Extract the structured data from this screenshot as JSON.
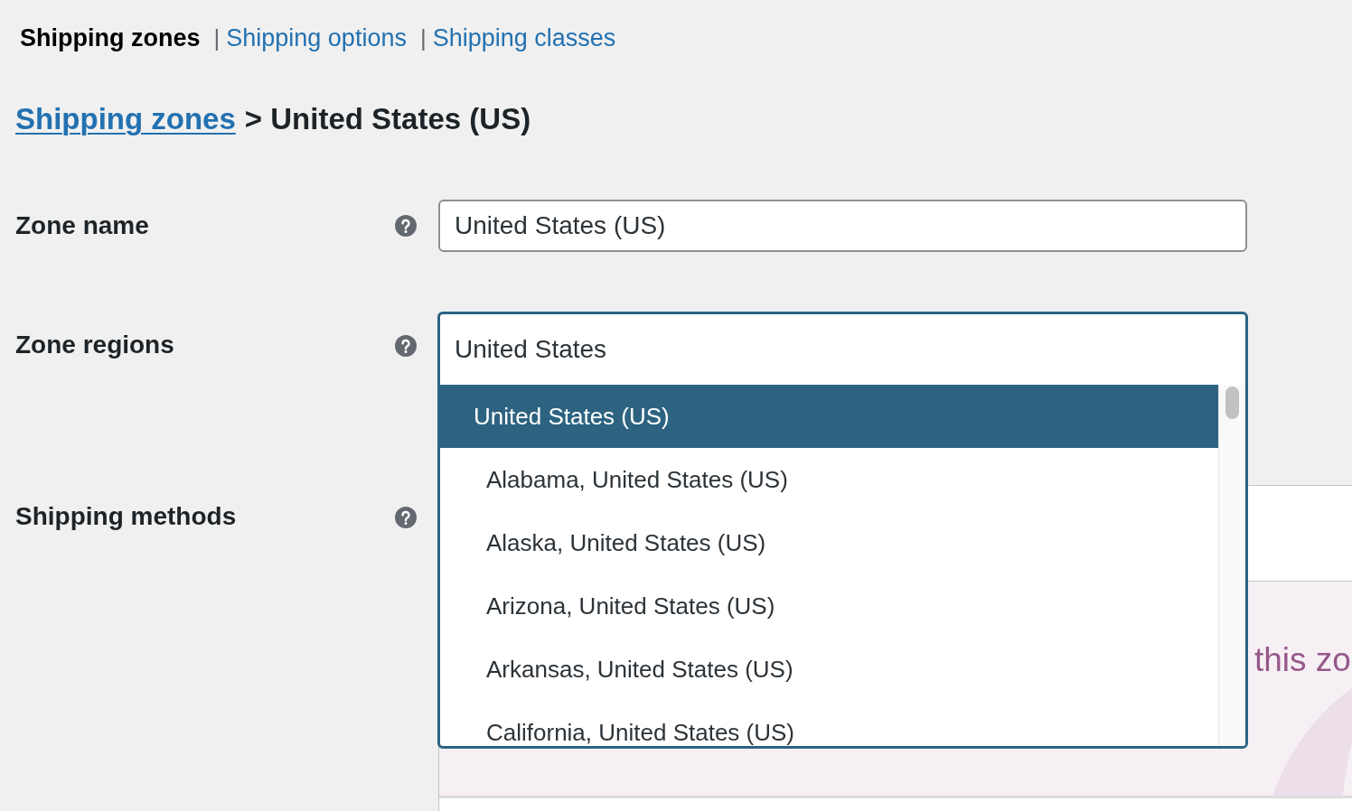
{
  "nav": [
    {
      "label": "Shipping zones",
      "selected": true
    },
    {
      "label": "Shipping options",
      "selected": false,
      "separator": "|"
    },
    {
      "label": "Shipping classes",
      "selected": false,
      "separator": "|"
    }
  ],
  "breadcrumb": {
    "link": "Shipping zones",
    "title": "> United States (US)"
  },
  "fields": [
    {
      "kind": "text",
      "label": "Zone name",
      "value": "United States (US)"
    },
    {
      "kind": "region-select",
      "label": "Zone regions",
      "search": "United States",
      "expanded": true,
      "options": [
        {
          "label": "United States (US)",
          "selected": true,
          "children": [
            {
              "label": "Alabama, United States (US)",
              "selected": false
            },
            {
              "label": "Alaska, United States (US)",
              "selected": false
            },
            {
              "label": "Arizona, United States (US)",
              "selected": false
            },
            {
              "label": "Arkansas, United States (US)",
              "selected": false
            },
            {
              "label": "California, United States (US)",
              "selected": false
            }
          ]
        }
      ]
    },
    {
      "kind": "methods",
      "label": "Shipping methods",
      "notice": "this zo"
    }
  ]
}
